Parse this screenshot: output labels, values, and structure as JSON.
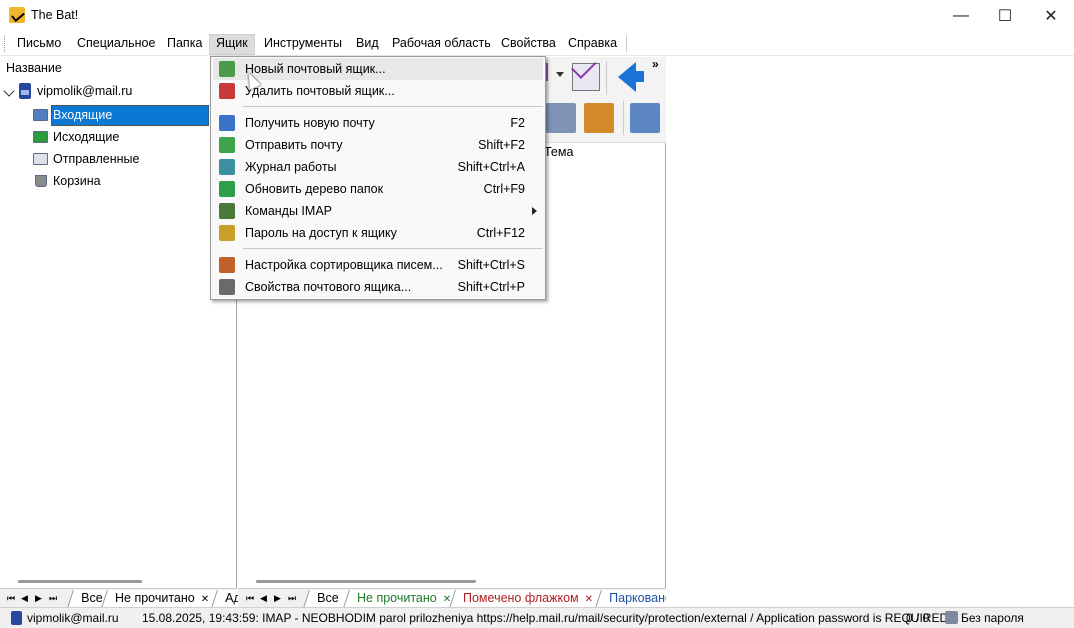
{
  "window": {
    "title": "The Bat!",
    "minimize": "—",
    "maximize": "☐",
    "close": "✕"
  },
  "menubar": {
    "items": [
      "Письмо",
      "Специальное",
      "Папка",
      "Ящик",
      "Инструменты",
      "Вид",
      "Рабочая область",
      "Свойства",
      "Справка"
    ]
  },
  "left_pane": {
    "header": "Название",
    "account": "vipmolik@mail.ru",
    "folders": [
      "Входящие",
      "Исходящие",
      "Отправленные",
      "Корзина"
    ]
  },
  "right_pane": {
    "column_subject": "Тема",
    "more_glyph": "»"
  },
  "dropdown": {
    "items": [
      {
        "label": "Новый почтовый ящик...",
        "shortcut": "",
        "icon": "new-mailbox-icon",
        "color": "#4a9b4a"
      },
      {
        "label": "Удалить почтовый ящик...",
        "shortcut": "",
        "icon": "delete-mailbox-icon",
        "color": "#c83a3a"
      },
      {
        "label": "Получить новую почту",
        "shortcut": "F2",
        "icon": "receive-mail-icon",
        "color": "#3a72c8"
      },
      {
        "label": "Отправить почту",
        "shortcut": "Shift+F2",
        "icon": "send-mail-icon",
        "color": "#3fa34a"
      },
      {
        "label": "Журнал работы",
        "shortcut": "Shift+Ctrl+A",
        "icon": "log-icon",
        "color": "#3a8fa0"
      },
      {
        "label": "Обновить дерево папок",
        "shortcut": "Ctrl+F9",
        "icon": "refresh-tree-icon",
        "color": "#2d9e4a"
      },
      {
        "label": "Команды IMAP",
        "shortcut": "",
        "icon": "imap-icon",
        "color": "#4a7a3a"
      },
      {
        "label": "Пароль на доступ к ящику",
        "shortcut": "Ctrl+F12",
        "icon": "password-lock-icon",
        "color": "#c7a02a"
      },
      {
        "label": "Настройка сортировщика писем...",
        "shortcut": "Shift+Ctrl+S",
        "icon": "sorter-icon",
        "color": "#c0602a"
      },
      {
        "label": "Свойства почтового ящика...",
        "shortcut": "Shift+Ctrl+P",
        "icon": "mailbox-properties-icon",
        "color": "#6a6a6a"
      }
    ]
  },
  "left_tabs": {
    "nav": [
      "⏮",
      "◀",
      "▶",
      "⏭"
    ],
    "tabs": [
      "Все",
      "Не прочитано",
      "Ад"
    ],
    "close_glyph": "✕"
  },
  "right_tabs": {
    "nav": [
      "⏮",
      "◀",
      "▶",
      "⏭"
    ],
    "tabs": [
      "Все",
      "Не прочитано",
      "Помечено флажком",
      "Парковано"
    ],
    "close_glyph": "✕"
  },
  "statusbar": {
    "account": "vipmolik@mail.ru",
    "message": "15.08.2025, 19:43:59: IMAP  - NEOBHODIM parol prilozheniya https://help.mail.ru/mail/security/protection/external / Application password is REQUIRED",
    "count": "0 / 0",
    "password_state": "Без пароля"
  }
}
